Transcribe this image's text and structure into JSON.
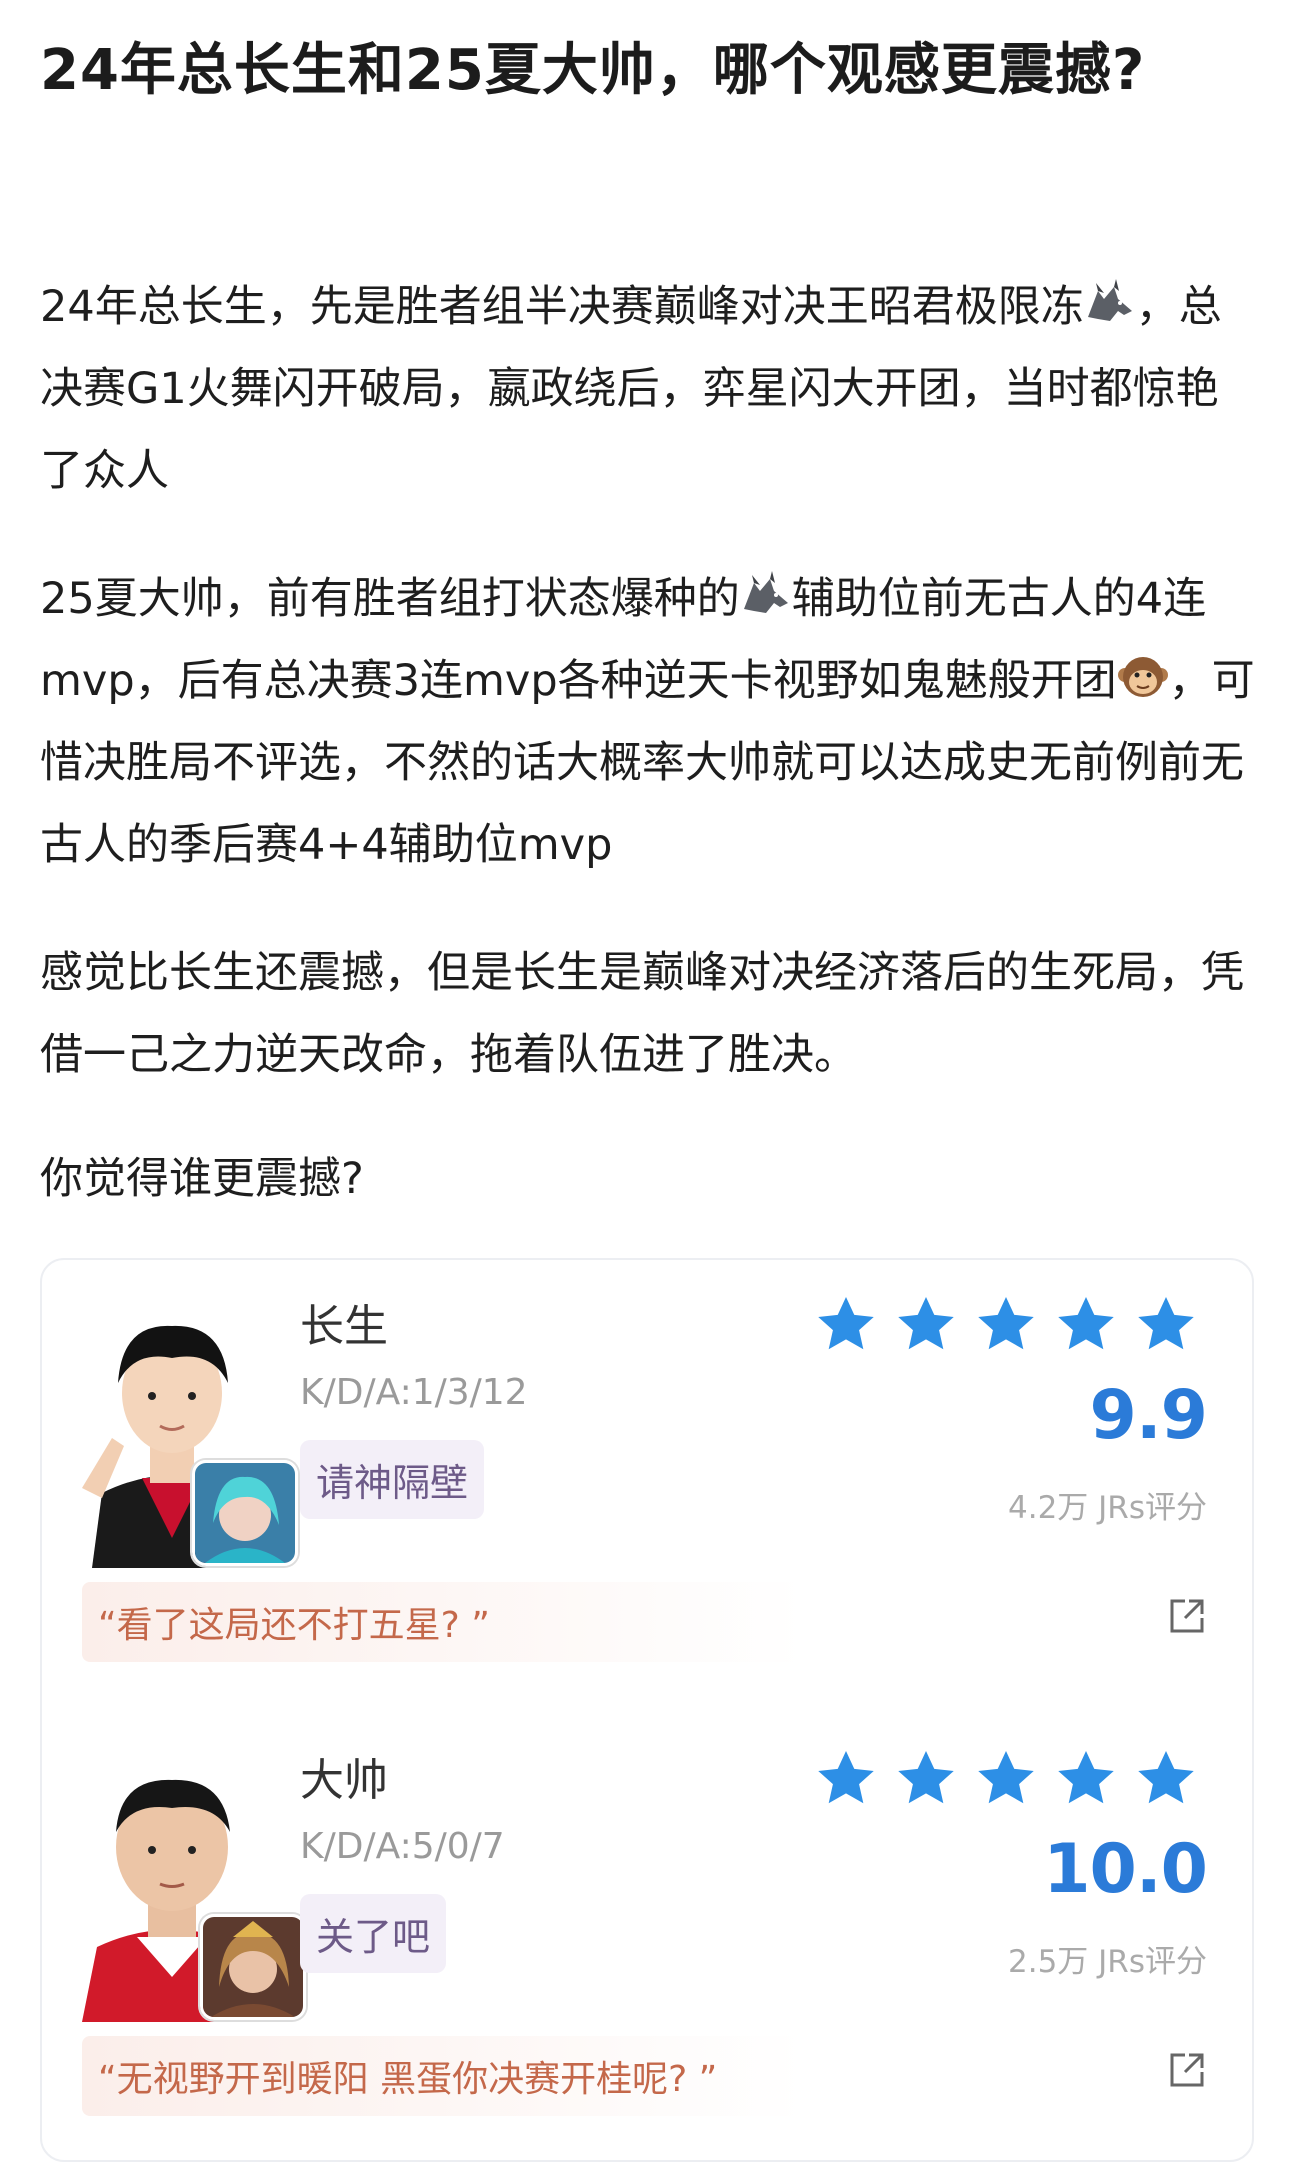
{
  "post": {
    "title": "24年总长生和25夏大帅，哪个观感更震撼?",
    "p1_a": "24年总长生，先是胜者组半决赛巅峰对决王昭君极限冻",
    "p1_b": "，总决赛G1火舞闪开破局，嬴政绕后，弈星闪大开团，当时都惊艳了众人",
    "p2_a": "25夏大帅，前有胜者组打状态爆种的",
    "p2_b": "辅助位前无古人的4连mvp，后有总决赛3连mvp各种逆天卡视野如鬼魅般开团",
    "p2_c": "，可惜决胜局不评选，不然的话大概率大帅就可以达成史无前例前无古人的季后赛4+4辅助位mvp",
    "p3": "感觉比长生还震撼，但是长生是巅峰对决经济落后的生死局，凭借一己之力逆天改命，拖着队伍进了胜决。",
    "p4": "你觉得谁更震撼?"
  },
  "ratings": [
    {
      "name": "长生",
      "kda": "K/D/A:1/3/12",
      "tag": "请神隔壁",
      "stars": 5,
      "score": "9.9",
      "raters": "4.2万 JRs评分",
      "quote": "“看了这局还不打五星? ”"
    },
    {
      "name": "大帅",
      "kda": "K/D/A:5/0/7",
      "tag": "关了吧",
      "stars": 5,
      "score": "10.0",
      "raters": "2.5万 JRs评分",
      "quote": "“无视野开到暖阳 黑蛋你决赛开桂呢? ”"
    }
  ],
  "colors": {
    "star": "#2d8fe6",
    "score": "#2b7bd8",
    "quote": "#c4684a",
    "tag_bg": "#f3eff8"
  },
  "icons": [
    "wolf-emoji-icon",
    "monkey-emoji-icon",
    "star-icon",
    "share-icon"
  ]
}
